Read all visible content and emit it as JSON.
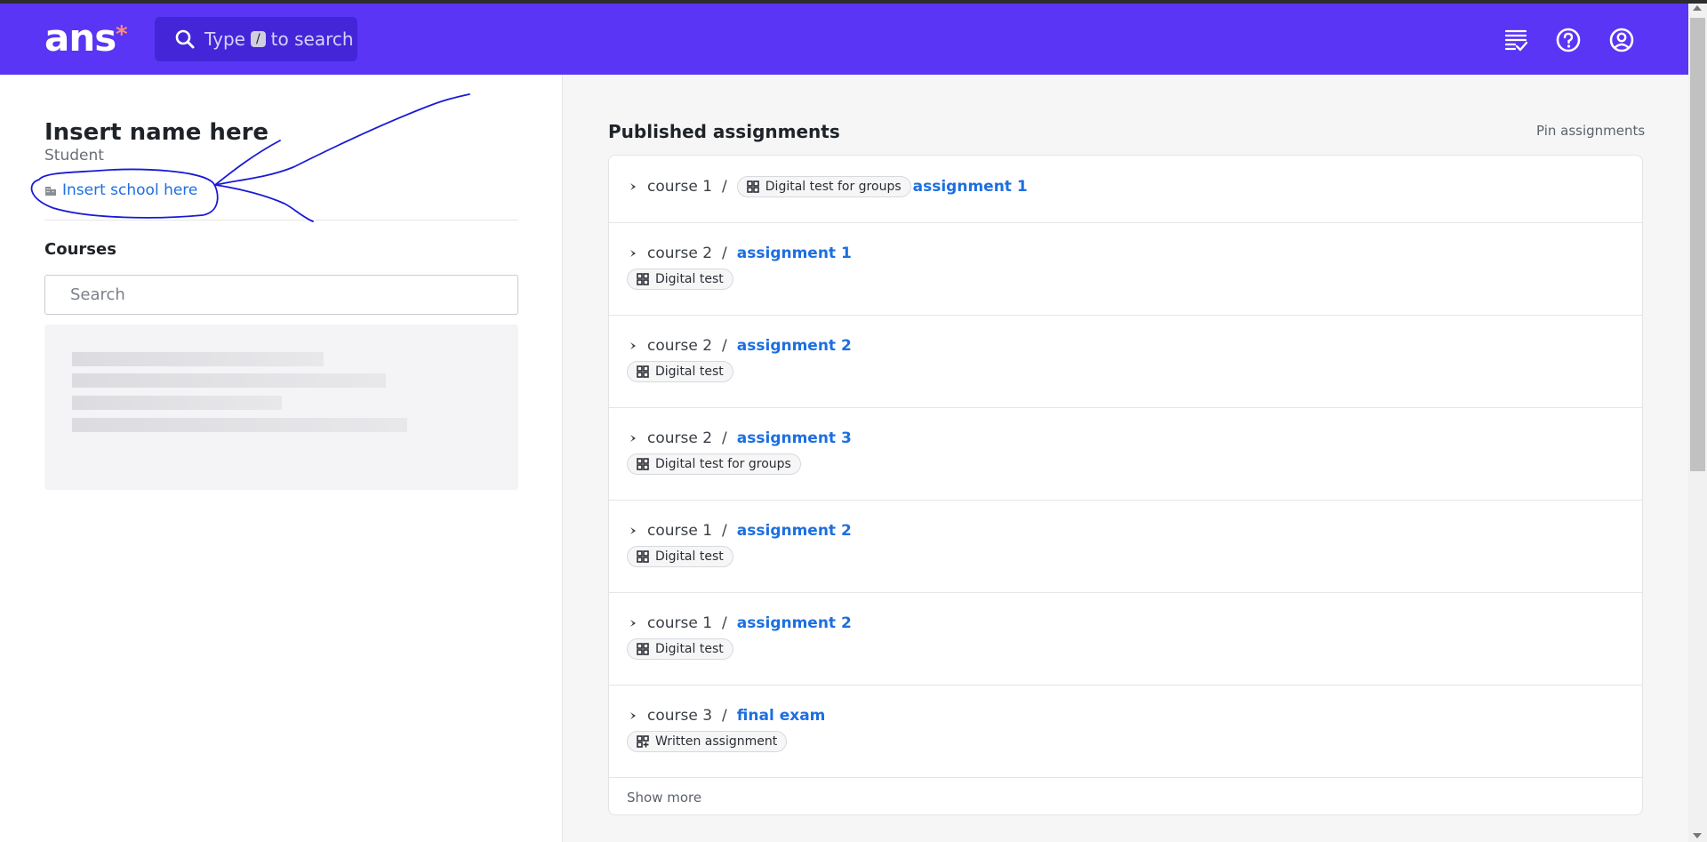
{
  "header": {
    "logo_text": "ans",
    "logo_mark": "*",
    "search_prefix": "Type",
    "search_key": "/",
    "search_suffix": "to search",
    "icons": [
      "assignments-list-icon",
      "help-icon",
      "account-icon"
    ],
    "brand_color": "#5a35f5"
  },
  "profile": {
    "name": "Insert name here",
    "role": "Student",
    "school": "Insert school here"
  },
  "courses": {
    "title": "Courses",
    "search_placeholder": "Search"
  },
  "published": {
    "title": "Published assignments",
    "pin_label": "Pin assignments",
    "show_more": "Show more",
    "rows": [
      {
        "course": "course 1",
        "assignment": "assignment 1",
        "type": "Digital test for groups"
      },
      {
        "course": "course 2",
        "assignment": "assignment 1",
        "type": "Digital test"
      },
      {
        "course": "course 2",
        "assignment": "assignment 2",
        "type": "Digital test"
      },
      {
        "course": "course 2",
        "assignment": "assignment 3",
        "type": "Digital test for groups"
      },
      {
        "course": "course 1",
        "assignment": "assignment 2",
        "type": "Digital test"
      },
      {
        "course": "course 1",
        "assignment": "assignment 2",
        "type": "Digital test"
      },
      {
        "course": "course 3",
        "assignment": "final exam",
        "type": "Written assignment"
      }
    ],
    "separator": "/"
  }
}
